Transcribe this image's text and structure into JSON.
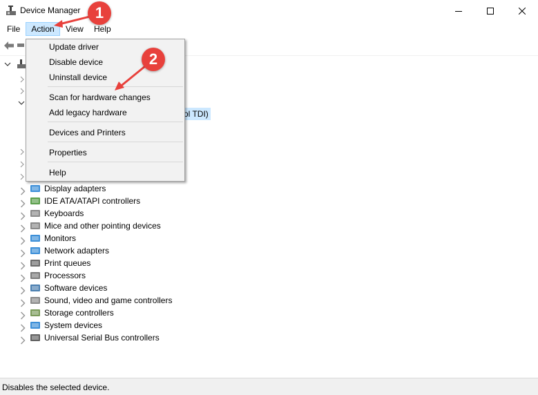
{
  "window": {
    "title": "Device Manager",
    "minimize_label": "Minimize",
    "maximize_label": "Maximize",
    "close_label": "Close"
  },
  "menu": {
    "file": "File",
    "action": "Action",
    "view": "View",
    "help": "Help"
  },
  "action_menu": {
    "items": [
      "Update driver",
      "Disable device",
      "Uninstall device",
      "Scan for hardware changes",
      "Add legacy hardware",
      "Devices and Printers",
      "Properties",
      "Help"
    ]
  },
  "tree": {
    "partial_visible_text": "ol TDI)",
    "categories": [
      {
        "label": "Display adapters",
        "icon": "display-adapter-icon"
      },
      {
        "label": "IDE ATA/ATAPI controllers",
        "icon": "ide-controller-icon"
      },
      {
        "label": "Keyboards",
        "icon": "keyboard-icon"
      },
      {
        "label": "Mice and other pointing devices",
        "icon": "mouse-icon"
      },
      {
        "label": "Monitors",
        "icon": "monitor-icon"
      },
      {
        "label": "Network adapters",
        "icon": "network-adapter-icon"
      },
      {
        "label": "Print queues",
        "icon": "printer-icon"
      },
      {
        "label": "Processors",
        "icon": "processor-icon"
      },
      {
        "label": "Software devices",
        "icon": "software-device-icon"
      },
      {
        "label": "Sound, video and game controllers",
        "icon": "speaker-icon"
      },
      {
        "label": "Storage controllers",
        "icon": "storage-controller-icon"
      },
      {
        "label": "System devices",
        "icon": "system-device-icon"
      },
      {
        "label": "Universal Serial Bus controllers",
        "icon": "usb-icon"
      }
    ]
  },
  "annotations": {
    "step1": "1",
    "step2": "2",
    "color": "#e8413c"
  },
  "status": {
    "text": "Disables the selected device."
  }
}
